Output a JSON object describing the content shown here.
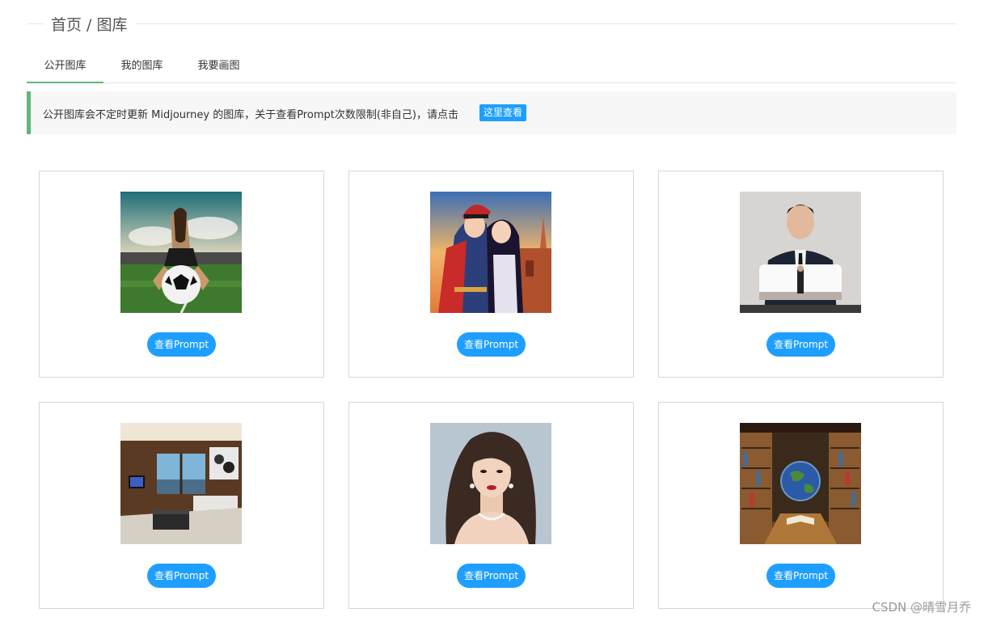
{
  "header": {
    "title": "首页 / 图库"
  },
  "tabs": [
    {
      "label": "公开图库",
      "active": true
    },
    {
      "label": "我的图库",
      "active": false
    },
    {
      "label": "我要画图",
      "active": false
    }
  ],
  "notice": {
    "text": "公开图库会不定时更新 Midjourney 的图库，关于查看Prompt次数限制(非自己)，请点击",
    "link_label": "这里查看"
  },
  "gallery": {
    "items": [
      {
        "image": "soccer-girl-on-ball-stadium",
        "button_label": "查看Prompt"
      },
      {
        "image": "anime-couple-kiss-sunset-castle",
        "button_label": "查看Prompt"
      },
      {
        "image": "man-in-suit-with-screen",
        "button_label": "查看Prompt"
      },
      {
        "image": "luxury-living-room-interior",
        "button_label": "查看Prompt"
      },
      {
        "image": "woman-portrait-earrings",
        "button_label": "查看Prompt"
      },
      {
        "image": "library-with-earth-globe",
        "button_label": "查看Prompt"
      }
    ]
  },
  "watermark": "CSDN @晴雪月乔",
  "colors": {
    "accent_green": "#5FB878",
    "button_blue": "#1E9FFF"
  }
}
